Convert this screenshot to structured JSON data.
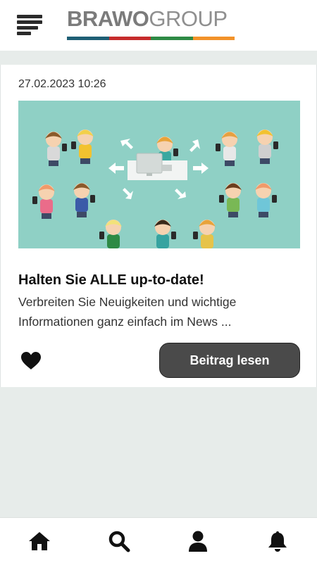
{
  "header": {
    "menu_icon": "hamburger-menu-icon",
    "logo": {
      "text_bold": "BRAWO",
      "text_light": "GROUP",
      "stripe_colors": [
        "#1f5f75",
        "#c62c2c",
        "#2e8a45",
        "#f2922a"
      ]
    }
  },
  "post": {
    "date": "27.02.2023 10:26",
    "title": "Halten Sie ALLE up-to-date!",
    "excerpt": "Verbreiten Sie Neuigkeiten und wichtige Informationen ganz einfach im News ...",
    "like_icon": "heart-icon",
    "read_button": "Beitrag lesen",
    "image_background": "#8fd0c5"
  },
  "bottom_nav": [
    {
      "icon": "home-icon"
    },
    {
      "icon": "search-icon"
    },
    {
      "icon": "user-icon"
    },
    {
      "icon": "bell-icon"
    }
  ]
}
